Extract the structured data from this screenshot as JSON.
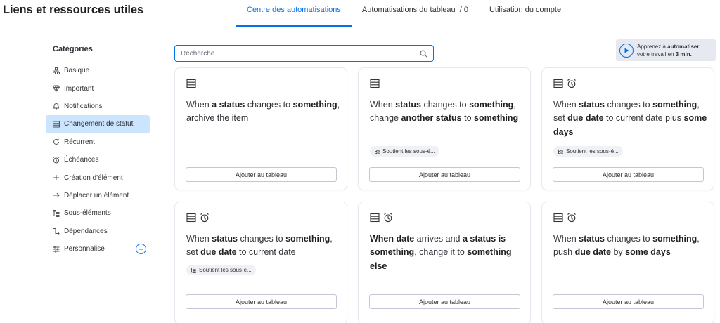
{
  "header": {
    "title": "Liens et ressources utiles",
    "tabs": [
      {
        "label": "Centre des automatisations"
      },
      {
        "label": "Automatisations du tableau  / 0"
      },
      {
        "label": "Utilisation du compte"
      }
    ]
  },
  "sidebar": {
    "title": "Catégories",
    "items": [
      {
        "label": "Basique",
        "icon": "sitemap-icon"
      },
      {
        "label": "Important",
        "icon": "gem-icon"
      },
      {
        "label": "Notifications",
        "icon": "bell-icon"
      },
      {
        "label": "Changement de statut",
        "icon": "table-icon"
      },
      {
        "label": "Récurrent",
        "icon": "refresh-icon"
      },
      {
        "label": "Échéances",
        "icon": "alarm-icon"
      },
      {
        "label": "Création d'élément",
        "icon": "plus-icon"
      },
      {
        "label": "Déplacer un élément",
        "icon": "arrow-right-icon"
      },
      {
        "label": "Sous-éléments",
        "icon": "subitems-icon"
      },
      {
        "label": "Dépendances",
        "icon": "dependency-icon"
      },
      {
        "label": "Personnalisé",
        "icon": "sliders-icon"
      }
    ],
    "add_label": "+"
  },
  "search": {
    "placeholder": "Recherche",
    "value": ""
  },
  "learn": {
    "prefix": "Apprenez à ",
    "bold1": "automatiser",
    "line2_prefix": "votre travail en ",
    "bold2": "3 min",
    "suffix": "."
  },
  "cards": {
    "add_label": "Ajouter au tableau",
    "tag_label": "Soutient les sous-é...",
    "c1": {
      "t1": "When ",
      "b1": "a status",
      "t2": " changes to ",
      "b2": "something",
      "t3": ", archive the item"
    },
    "c2": {
      "t1": "When ",
      "b1": "status",
      "t2": " changes to ",
      "b2": "something",
      "t3": ", change ",
      "b3": "another status",
      "t4": " to ",
      "b4": "something"
    },
    "c3": {
      "t1": "When ",
      "b1": "status",
      "t2": " changes to ",
      "b2": "something",
      "t3": ", set ",
      "b3": "due date",
      "t4": " to current date plus ",
      "b4": "some days"
    },
    "c4": {
      "t1": "When ",
      "b1": "status",
      "t2": " changes to ",
      "b2": "something",
      "t3": ", set ",
      "b3": "due date",
      "t4": " to current date"
    },
    "c5": {
      "b1": "When date",
      "t1": " arrives and ",
      "b2": "a status is something",
      "t2": ", change it to ",
      "b3": "something else"
    },
    "c6": {
      "t1": "When ",
      "b1": "status",
      "t2": " changes to ",
      "b2": "something",
      "t3": ", push ",
      "b3": "due date",
      "t4": " by ",
      "b4": "some days"
    }
  },
  "colors": {
    "accent": "#0073ea",
    "selected": "#cce5ff",
    "learn_bg": "#e6e9ef"
  }
}
